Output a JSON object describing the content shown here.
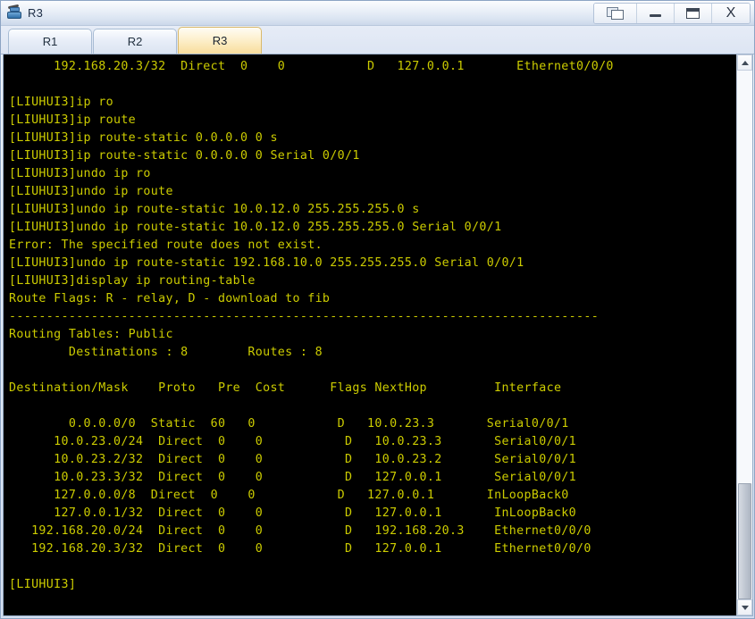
{
  "window": {
    "title": "R3",
    "icon": "router-device-icon",
    "controls": [
      {
        "name": "cascade-windows-button",
        "glyph": "cascade-windows-icon",
        "label": ""
      },
      {
        "name": "minimize-button",
        "glyph": "minimize-icon",
        "label": ""
      },
      {
        "name": "maximize-button",
        "glyph": "maximize-icon",
        "label": ""
      },
      {
        "name": "close-button",
        "glyph": "close-icon",
        "label": "X"
      }
    ]
  },
  "tabs": [
    {
      "label": "R1",
      "active": false
    },
    {
      "label": "R2",
      "active": false
    },
    {
      "label": "R3",
      "active": true
    }
  ],
  "colors": {
    "terminal_bg": "#000000",
    "terminal_fg": "#cccc00",
    "active_tab": "#f8dd9c",
    "titlebar": "#e2eaf5"
  },
  "terminal": {
    "prompt": "[LIUHUI3]",
    "lines": [
      "      192.168.20.3/32  Direct  0    0           D   127.0.0.1       Ethernet0/0/0",
      "",
      "[LIUHUI3]ip ro",
      "[LIUHUI3]ip route",
      "[LIUHUI3]ip route-static 0.0.0.0 0 s",
      "[LIUHUI3]ip route-static 0.0.0.0 0 Serial 0/0/1",
      "[LIUHUI3]undo ip ro",
      "[LIUHUI3]undo ip route",
      "[LIUHUI3]undo ip route-static 10.0.12.0 255.255.255.0 s",
      "[LIUHUI3]undo ip route-static 10.0.12.0 255.255.255.0 Serial 0/0/1",
      "Error: The specified route does not exist.",
      "[LIUHUI3]undo ip route-static 192.168.10.0 255.255.255.0 Serial 0/0/1",
      "[LIUHUI3]display ip routing-table",
      "Route Flags: R - relay, D - download to fib",
      "-------------------------------------------------------------------------------",
      "Routing Tables: Public",
      "        Destinations : 8        Routes : 8",
      "",
      "Destination/Mask    Proto   Pre  Cost      Flags NextHop         Interface",
      "",
      "        0.0.0.0/0  Static  60   0           D   10.0.23.3       Serial0/0/1",
      "      10.0.23.0/24  Direct  0    0           D   10.0.23.3       Serial0/0/1",
      "      10.0.23.2/32  Direct  0    0           D   10.0.23.2       Serial0/0/1",
      "      10.0.23.3/32  Direct  0    0           D   127.0.0.1       Serial0/0/1",
      "      127.0.0.0/8  Direct  0    0           D   127.0.0.1       InLoopBack0",
      "      127.0.0.1/32  Direct  0    0           D   127.0.0.1       InLoopBack0",
      "   192.168.20.0/24  Direct  0    0           D   192.168.20.3    Ethernet0/0/0",
      "   192.168.20.3/32  Direct  0    0           D   127.0.0.1       Ethernet0/0/0",
      "",
      "[LIUHUI3]"
    ],
    "routing_table": {
      "flags_legend": "Route Flags: R - relay, D - download to fib",
      "table_scope": "Routing Tables: Public",
      "destinations": "8",
      "routes": "8",
      "columns": [
        "Destination/Mask",
        "Proto",
        "Pre",
        "Cost",
        "Flags",
        "NextHop",
        "Interface"
      ],
      "rows": [
        [
          "0.0.0.0/0",
          "Static",
          "60",
          "0",
          "D",
          "10.0.23.3",
          "Serial0/0/1"
        ],
        [
          "10.0.23.0/24",
          "Direct",
          "0",
          "0",
          "D",
          "10.0.23.3",
          "Serial0/0/1"
        ],
        [
          "10.0.23.2/32",
          "Direct",
          "0",
          "0",
          "D",
          "10.0.23.2",
          "Serial0/0/1"
        ],
        [
          "10.0.23.3/32",
          "Direct",
          "0",
          "0",
          "D",
          "127.0.0.1",
          "Serial0/0/1"
        ],
        [
          "127.0.0.0/8",
          "Direct",
          "0",
          "0",
          "D",
          "127.0.0.1",
          "InLoopBack0"
        ],
        [
          "127.0.0.1/32",
          "Direct",
          "0",
          "0",
          "D",
          "127.0.0.1",
          "InLoopBack0"
        ],
        [
          "192.168.20.0/24",
          "Direct",
          "0",
          "0",
          "D",
          "192.168.20.3",
          "Ethernet0/0/0"
        ],
        [
          "192.168.20.3/32",
          "Direct",
          "0",
          "0",
          "D",
          "127.0.0.1",
          "Ethernet0/0/0"
        ]
      ]
    },
    "error_message": "Error: The specified route does not exist."
  },
  "scrollbar": {
    "up_arrow": "chevron-up-icon",
    "down_arrow": "chevron-down-icon",
    "thumb_top_percent": 78,
    "thumb_height_percent": 22
  }
}
